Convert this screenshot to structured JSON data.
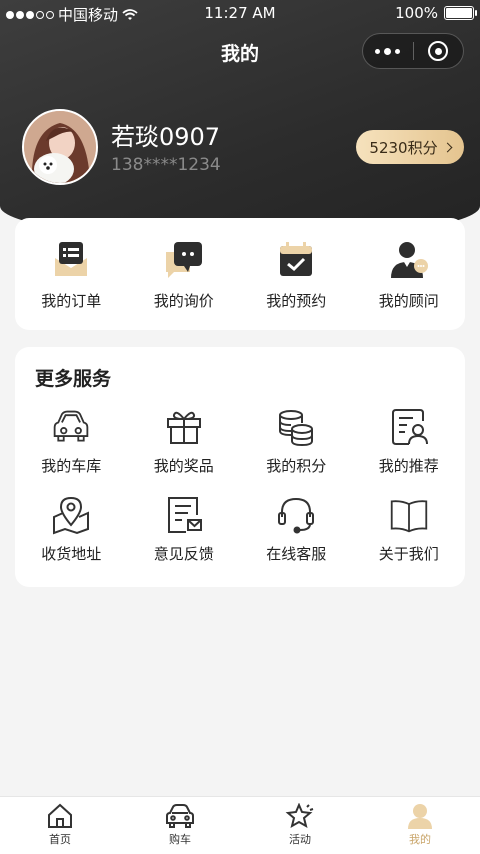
{
  "status_bar": {
    "carrier": "中国移动",
    "time": "11:27 AM",
    "battery": "100%",
    "battery_level": 1.0
  },
  "nav": {
    "title": "我的",
    "more_icon": "more-dots-icon",
    "close_icon": "capsule-close-icon"
  },
  "profile": {
    "name": "若琰0907",
    "phone": "138****1234",
    "points_label": "5230积分"
  },
  "orders": [
    {
      "label": "我的订单",
      "icon": "order-list-icon"
    },
    {
      "label": "我的询价",
      "icon": "inquiry-chat-icon"
    },
    {
      "label": "我的预约",
      "icon": "appointment-calendar-icon"
    },
    {
      "label": "我的顾问",
      "icon": "advisor-icon"
    }
  ],
  "services": {
    "title": "更多服务",
    "items": [
      {
        "label": "我的车库",
        "icon": "garage-car-icon"
      },
      {
        "label": "我的奖品",
        "icon": "gift-icon"
      },
      {
        "label": "我的积分",
        "icon": "points-coins-icon"
      },
      {
        "label": "我的推荐",
        "icon": "recommend-card-icon"
      },
      {
        "label": "收货地址",
        "icon": "address-map-pin-icon"
      },
      {
        "label": "意见反馈",
        "icon": "feedback-document-icon"
      },
      {
        "label": "在线客服",
        "icon": "customer-service-headset-icon"
      },
      {
        "label": "关于我们",
        "icon": "about-book-icon"
      }
    ]
  },
  "tabbar": [
    {
      "label": "首页",
      "icon": "home-icon",
      "active": false
    },
    {
      "label": "购车",
      "icon": "car-icon",
      "active": false
    },
    {
      "label": "活动",
      "icon": "activity-star-icon",
      "active": false
    },
    {
      "label": "我的",
      "icon": "profile-icon",
      "active": true
    }
  ],
  "colors": {
    "header_dark": "#2c2c2c",
    "accent_gold": "#e4c48f",
    "active_tab": "#c9a56a",
    "page_bg": "#f4f4f4"
  }
}
